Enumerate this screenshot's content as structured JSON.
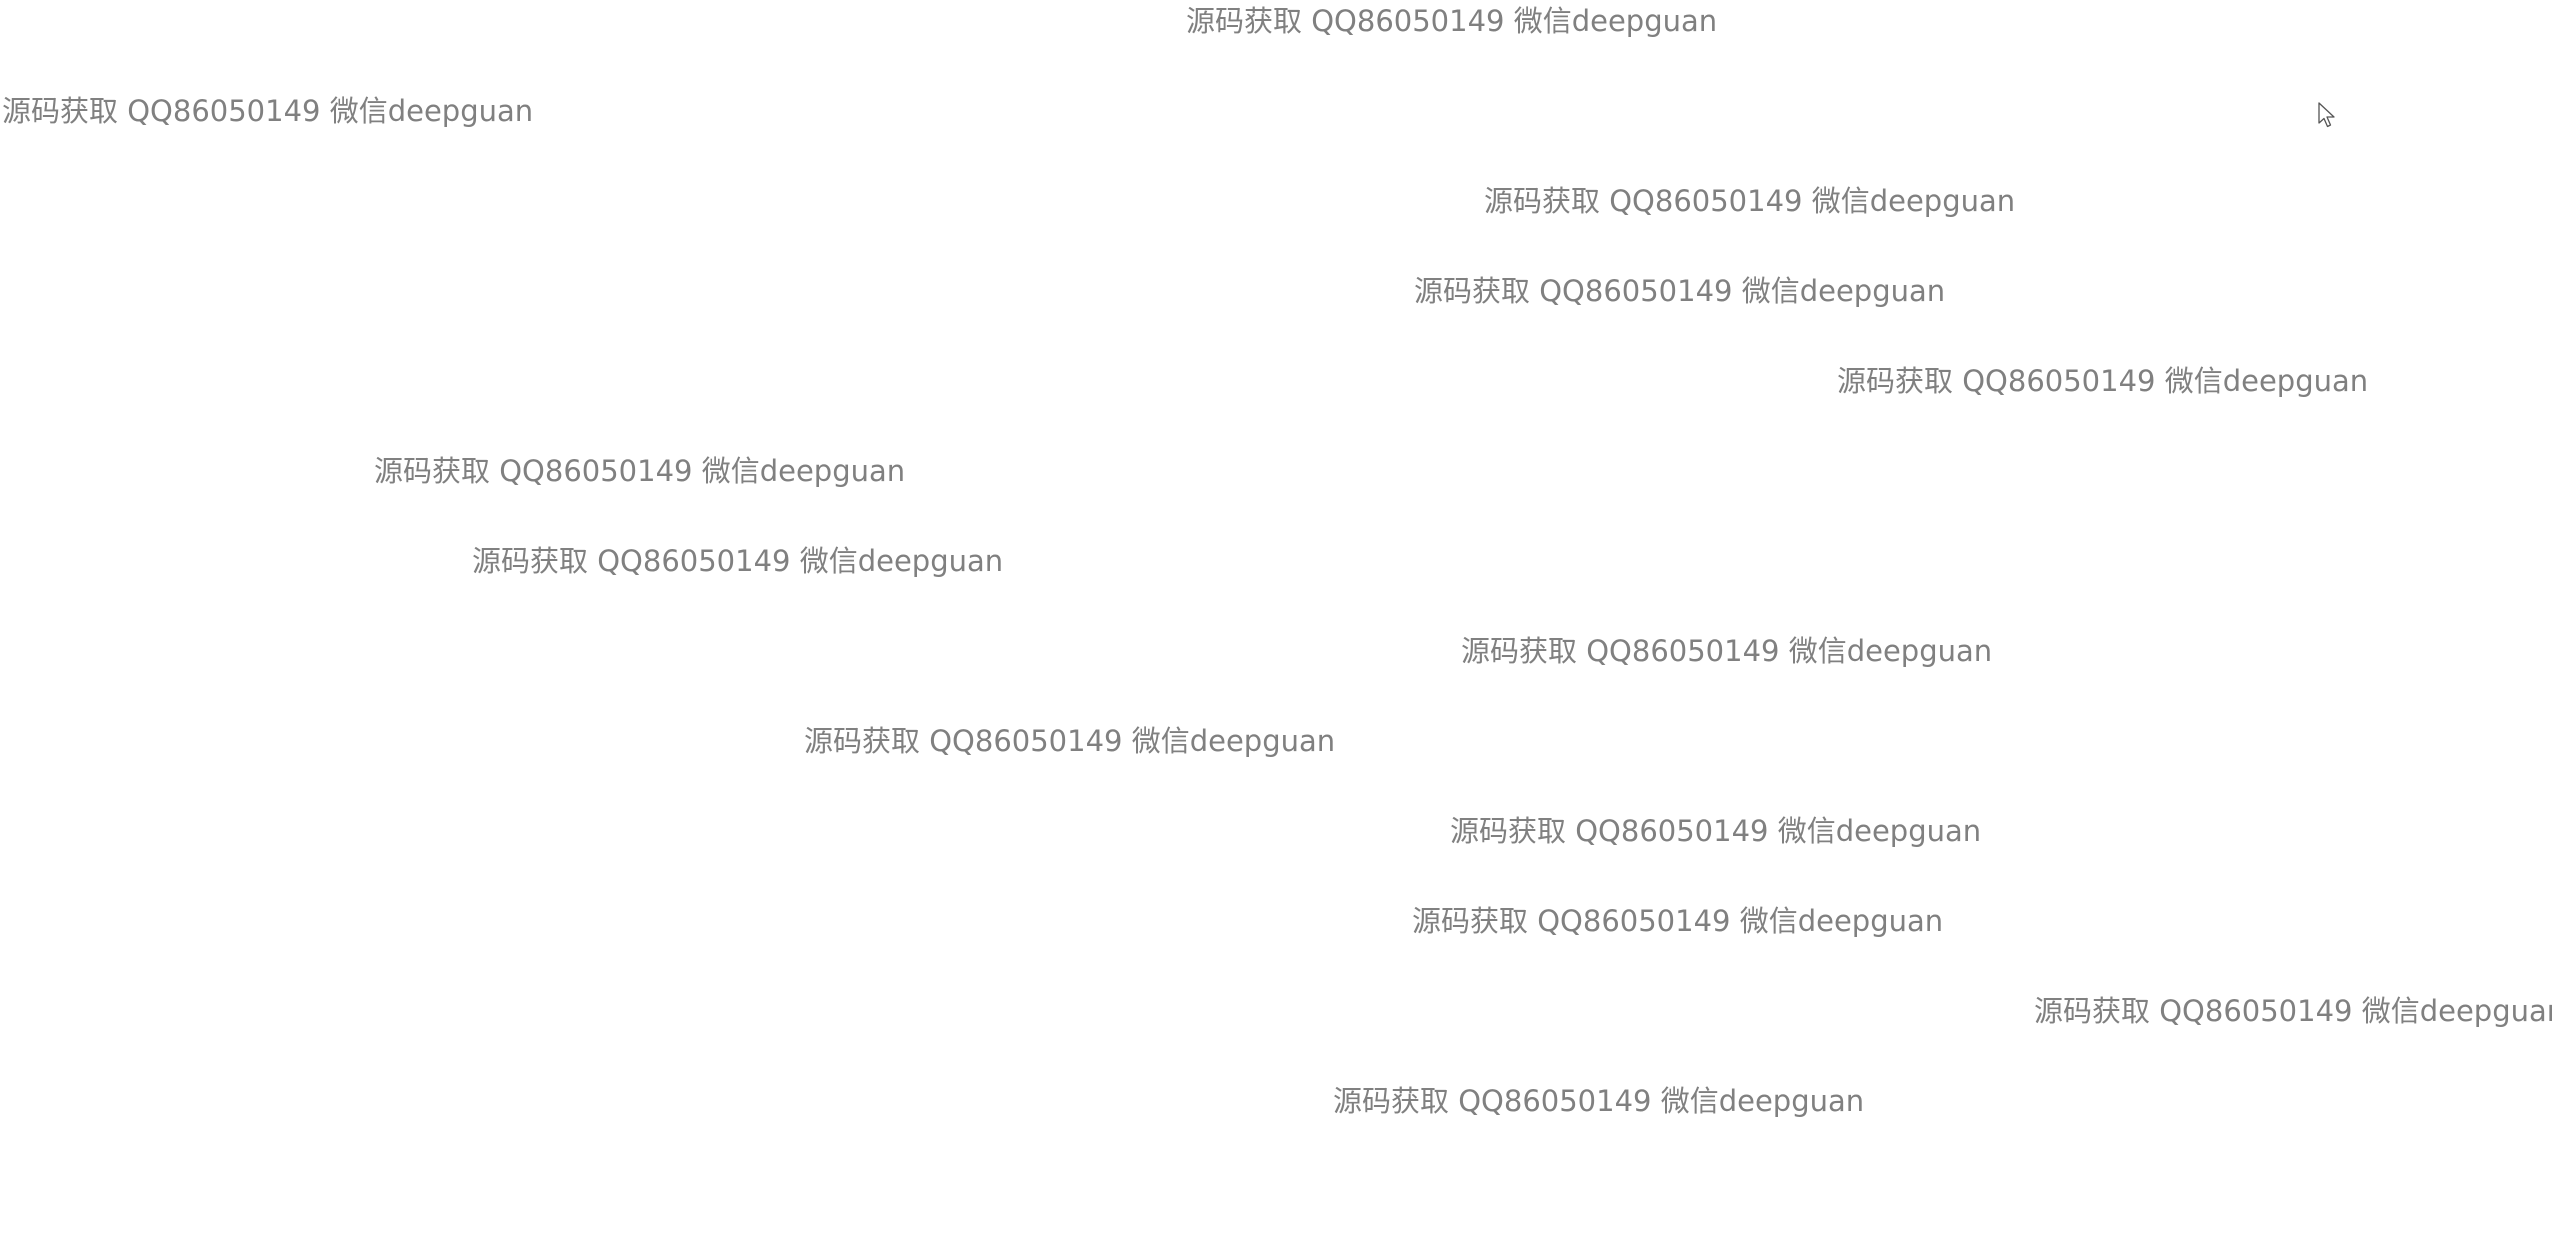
{
  "watermark": {
    "text": "源码获取 QQ86050149 微信deepguan",
    "color": "#808080"
  },
  "background_color": "#ffffff",
  "cursor_icon": "pointer-arrow-icon"
}
